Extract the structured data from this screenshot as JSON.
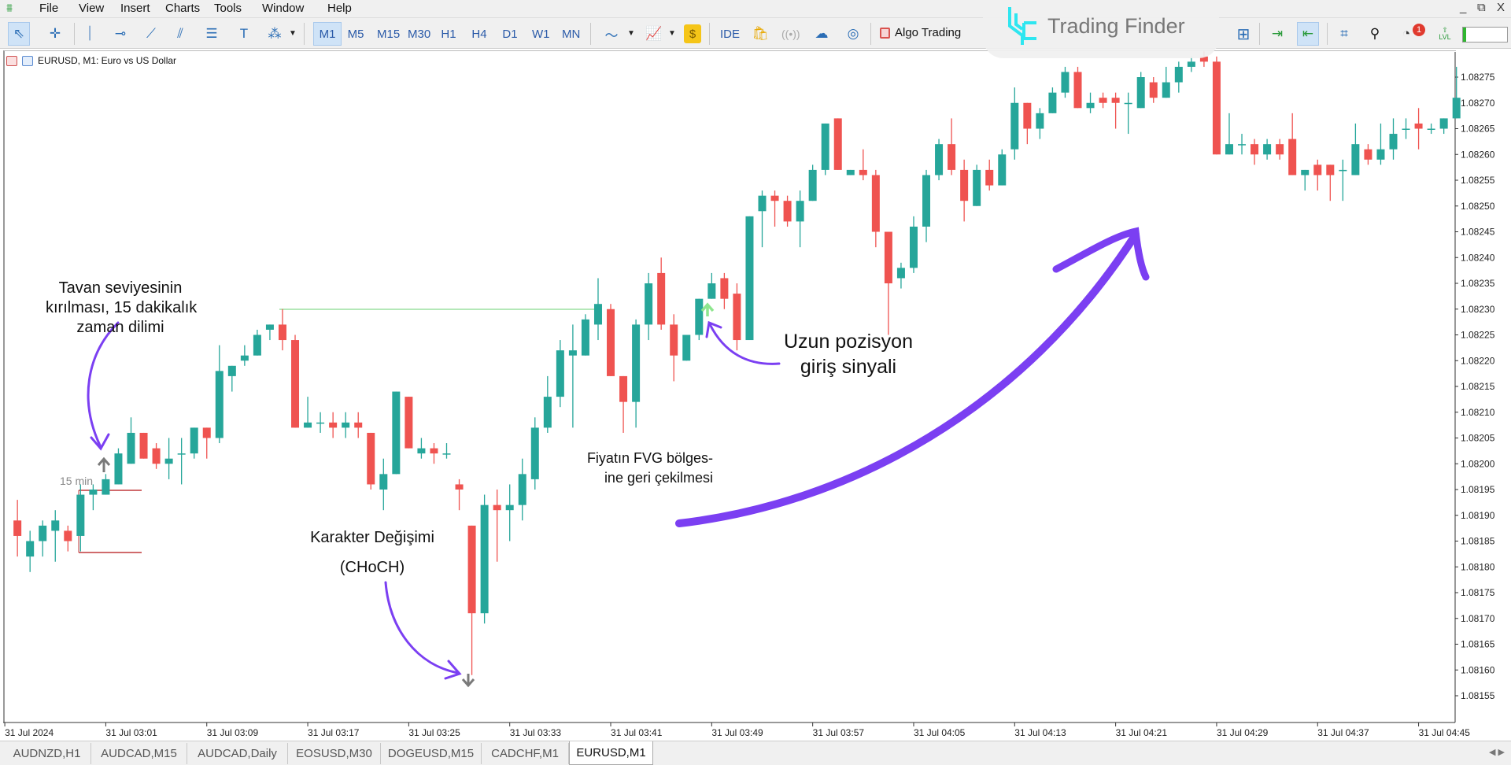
{
  "menu": {
    "items": [
      "File",
      "View",
      "Insert",
      "Charts",
      "Tools",
      "Window",
      "Help"
    ]
  },
  "window_controls": {
    "minimize": "_",
    "restore": "⧉",
    "close": "X"
  },
  "toolbar": {
    "tools": [
      {
        "name": "cursor",
        "glyph": "⇖",
        "active": true
      },
      {
        "name": "crosshair",
        "glyph": "✛"
      },
      {
        "name": "vertical-line",
        "glyph": "⏐"
      },
      {
        "name": "horizontal-line",
        "glyph": "⊸"
      },
      {
        "name": "trend-line",
        "glyph": "⟋"
      },
      {
        "name": "channels",
        "glyph": "⫽"
      },
      {
        "name": "fibonacci",
        "glyph": "☰"
      },
      {
        "name": "text",
        "glyph": "T"
      },
      {
        "name": "shapes",
        "glyph": "⁂"
      }
    ],
    "timeframes": [
      "M1",
      "M5",
      "M15",
      "M30",
      "H1",
      "H4",
      "D1",
      "W1",
      "MN"
    ],
    "active_timeframe": "M1",
    "ide_label": "IDE",
    "algo_trading_label": "Algo Trading",
    "notification_count": "1",
    "lvl_label": "LVL",
    "level_fill_percent": 7
  },
  "watermark": {
    "text": "Trading Finder",
    "color": "#2ee6f0"
  },
  "chart": {
    "title": "EURUSD, M1:  Euro vs US Dollar"
  },
  "colors": {
    "bull": "#26a69a",
    "bear": "#ef5350",
    "annotation_arrow": "#7b3ff2",
    "fvg_line": "#9be0a0",
    "box_line": "#c0393b"
  },
  "annotations": {
    "breakout": [
      "Tavan seviyesinin",
      "kırılması, 15 dakikalık",
      "zaman dilimi"
    ],
    "box_label": "15 min",
    "choch": [
      "Karakter Değişimi",
      "(CHoCH)"
    ],
    "fvg": [
      "Fiyatın FVG bölges-",
      "ine geri çekilmesi"
    ],
    "entry": [
      "Uzun pozisyon",
      "giriş sinyali"
    ]
  },
  "chart_data": {
    "type": "candlestick",
    "symbol": "EURUSD",
    "timeframe": "M1",
    "y_ticks": [
      "1.08275",
      "1.08270",
      "1.08265",
      "1.08260",
      "1.08255",
      "1.08250",
      "1.08245",
      "1.08240",
      "1.08235",
      "1.08230",
      "1.08225",
      "1.08220",
      "1.08215",
      "1.08210",
      "1.08205",
      "1.08200",
      "1.08195",
      "1.08190",
      "1.08185",
      "1.08180",
      "1.08175",
      "1.08170",
      "1.08165",
      "1.08160",
      "1.08155"
    ],
    "x_labels": [
      "31 Jul 2024",
      "31 Jul 03:01",
      "31 Jul 03:09",
      "31 Jul 03:17",
      "31 Jul 03:25",
      "31 Jul 03:33",
      "31 Jul 03:41",
      "31 Jul 03:49",
      "31 Jul 03:57",
      "31 Jul 04:05",
      "31 Jul 04:13",
      "31 Jul 04:21",
      "31 Jul 04:29",
      "31 Jul 04:37",
      "31 Jul 04:45"
    ],
    "ylim": [
      1.0815,
      1.0828
    ],
    "candle_fields": [
      "time",
      "open",
      "high",
      "low",
      "close"
    ],
    "candles": [
      [
        "02:54",
        1.08189,
        1.08193,
        1.08182,
        1.08186
      ],
      [
        "02:55",
        1.08182,
        1.08187,
        1.08179,
        1.08185
      ],
      [
        "02:56",
        1.08185,
        1.08189,
        1.08182,
        1.08188
      ],
      [
        "02:57",
        1.08187,
        1.08191,
        1.08181,
        1.08189
      ],
      [
        "02:58",
        1.08187,
        1.08188,
        1.08183,
        1.08185
      ],
      [
        "02:59",
        1.08186,
        1.08196,
        1.08183,
        1.08194
      ],
      [
        "03:00",
        1.08194,
        1.08196,
        1.08191,
        1.08195
      ],
      [
        "03:01",
        1.08194,
        1.08198,
        1.08194,
        1.08197
      ],
      [
        "03:02",
        1.08196,
        1.08203,
        1.08196,
        1.08202
      ],
      [
        "03:03",
        1.082,
        1.08209,
        1.082,
        1.08206
      ],
      [
        "03:04",
        1.08206,
        1.08206,
        1.08201,
        1.08201
      ],
      [
        "03:05",
        1.08203,
        1.08204,
        1.08199,
        1.082
      ],
      [
        "03:06",
        1.082,
        1.08205,
        1.08197,
        1.08201
      ],
      [
        "03:07",
        1.08202,
        1.08205,
        1.08196,
        1.08202
      ],
      [
        "03:08",
        1.08202,
        1.08207,
        1.08201,
        1.08207
      ],
      [
        "03:09",
        1.08207,
        1.08207,
        1.08201,
        1.08205
      ],
      [
        "03:10",
        1.08205,
        1.08223,
        1.08204,
        1.08218
      ],
      [
        "03:11",
        1.08217,
        1.08219,
        1.08214,
        1.08219
      ],
      [
        "03:12",
        1.0822,
        1.08223,
        1.08219,
        1.08221
      ],
      [
        "03:13",
        1.08221,
        1.08226,
        1.08221,
        1.08225
      ],
      [
        "03:14",
        1.08226,
        1.08227,
        1.08224,
        1.08227
      ],
      [
        "03:15",
        1.08227,
        1.0823,
        1.08222,
        1.08224
      ],
      [
        "03:16",
        1.08224,
        1.08225,
        1.08207,
        1.08207
      ],
      [
        "03:17",
        1.08207,
        1.08213,
        1.08207,
        1.08208
      ],
      [
        "03:18",
        1.08208,
        1.0821,
        1.08206,
        1.08208
      ],
      [
        "03:19",
        1.08208,
        1.0821,
        1.08205,
        1.08207
      ],
      [
        "03:20",
        1.08207,
        1.0821,
        1.08205,
        1.08208
      ],
      [
        "03:21",
        1.08208,
        1.0821,
        1.08205,
        1.08207
      ],
      [
        "03:22",
        1.08206,
        1.08206,
        1.08195,
        1.08196
      ],
      [
        "03:23",
        1.08195,
        1.08201,
        1.08191,
        1.08198
      ],
      [
        "03:24",
        1.08198,
        1.08214,
        1.08198,
        1.08214
      ],
      [
        "03:25",
        1.08213,
        1.08213,
        1.08203,
        1.08203
      ],
      [
        "03:26",
        1.08202,
        1.08205,
        1.08201,
        1.08203
      ],
      [
        "03:27",
        1.08203,
        1.08204,
        1.082,
        1.08202
      ],
      [
        "03:28",
        1.08202,
        1.08204,
        1.08201,
        1.08202
      ],
      [
        "03:29",
        1.08196,
        1.08197,
        1.08191,
        1.08195
      ],
      [
        "03:30",
        1.08188,
        1.08188,
        1.08159,
        1.08171
      ],
      [
        "03:31",
        1.08171,
        1.08194,
        1.08169,
        1.08192
      ],
      [
        "03:32",
        1.08192,
        1.08195,
        1.08181,
        1.08191
      ],
      [
        "03:33",
        1.08191,
        1.08196,
        1.08185,
        1.08192
      ],
      [
        "03:34",
        1.08192,
        1.08201,
        1.08189,
        1.08198
      ],
      [
        "03:35",
        1.08197,
        1.08209,
        1.08195,
        1.08207
      ],
      [
        "03:36",
        1.08207,
        1.08217,
        1.08206,
        1.08213
      ],
      [
        "03:37",
        1.08213,
        1.08224,
        1.08211,
        1.08222
      ],
      [
        "03:38",
        1.08221,
        1.08227,
        1.08207,
        1.08222
      ],
      [
        "03:39",
        1.08221,
        1.08229,
        1.08221,
        1.08228
      ],
      [
        "03:40",
        1.08227,
        1.08236,
        1.08224,
        1.08231
      ],
      [
        "03:41",
        1.0823,
        1.08231,
        1.08217,
        1.08217
      ],
      [
        "03:42",
        1.08217,
        1.08217,
        1.08206,
        1.08212
      ],
      [
        "03:43",
        1.08212,
        1.08228,
        1.08207,
        1.08227
      ],
      [
        "03:44",
        1.08227,
        1.08237,
        1.08224,
        1.08235
      ],
      [
        "03:45",
        1.08237,
        1.0824,
        1.08226,
        1.08227
      ],
      [
        "03:46",
        1.08227,
        1.08229,
        1.08216,
        1.08221
      ],
      [
        "03:47",
        1.0822,
        1.08225,
        1.0822,
        1.08225
      ],
      [
        "03:48",
        1.08225,
        1.08232,
        1.08224,
        1.08232
      ],
      [
        "03:49",
        1.08232,
        1.08237,
        1.08232,
        1.08235
      ],
      [
        "03:50",
        1.08236,
        1.08237,
        1.0823,
        1.08232
      ],
      [
        "03:51",
        1.08233,
        1.08235,
        1.08222,
        1.08224
      ],
      [
        "03:52",
        1.08224,
        1.08248,
        1.08224,
        1.08248
      ],
      [
        "03:53",
        1.08249,
        1.08253,
        1.08242,
        1.08252
      ],
      [
        "03:54",
        1.08252,
        1.08253,
        1.08246,
        1.08251
      ],
      [
        "03:55",
        1.08251,
        1.08252,
        1.08246,
        1.08247
      ],
      [
        "03:56",
        1.08247,
        1.08253,
        1.08242,
        1.08251
      ],
      [
        "03:57",
        1.08251,
        1.08258,
        1.08251,
        1.08257
      ],
      [
        "03:58",
        1.08257,
        1.08266,
        1.08256,
        1.08266
      ],
      [
        "03:59",
        1.08267,
        1.08267,
        1.08257,
        1.08257
      ],
      [
        "04:00",
        1.08256,
        1.08257,
        1.08256,
        1.08257
      ],
      [
        "04:01",
        1.08257,
        1.08261,
        1.08255,
        1.08256
      ],
      [
        "04:02",
        1.08256,
        1.08257,
        1.08242,
        1.08245
      ],
      [
        "04:03",
        1.08245,
        1.08245,
        1.08225,
        1.08235
      ],
      [
        "04:04",
        1.08236,
        1.08239,
        1.08234,
        1.08238
      ],
      [
        "04:05",
        1.08238,
        1.08248,
        1.08237,
        1.08246
      ],
      [
        "04:06",
        1.08246,
        1.08257,
        1.08243,
        1.08256
      ],
      [
        "04:07",
        1.08256,
        1.08263,
        1.08255,
        1.08262
      ],
      [
        "04:08",
        1.08262,
        1.08267,
        1.08256,
        1.08257
      ],
      [
        "04:09",
        1.08257,
        1.08259,
        1.08247,
        1.08251
      ],
      [
        "04:10",
        1.0825,
        1.08258,
        1.0825,
        1.08257
      ],
      [
        "04:11",
        1.08257,
        1.08259,
        1.08253,
        1.08254
      ],
      [
        "04:12",
        1.08254,
        1.08261,
        1.08254,
        1.0826
      ],
      [
        "04:13",
        1.08261,
        1.08273,
        1.08259,
        1.0827
      ],
      [
        "04:14",
        1.0827,
        1.0827,
        1.08262,
        1.08265
      ],
      [
        "04:15",
        1.08265,
        1.08269,
        1.08263,
        1.08268
      ],
      [
        "04:16",
        1.08268,
        1.08273,
        1.08268,
        1.08272
      ],
      [
        "04:17",
        1.08272,
        1.08277,
        1.08271,
        1.08276
      ],
      [
        "04:18",
        1.08276,
        1.08277,
        1.08269,
        1.08269
      ],
      [
        "04:19",
        1.08269,
        1.08272,
        1.08268,
        1.0827
      ],
      [
        "04:20",
        1.08271,
        1.08272,
        1.08269,
        1.0827
      ],
      [
        "04:21",
        1.08271,
        1.08272,
        1.08265,
        1.0827
      ],
      [
        "04:22",
        1.0827,
        1.08272,
        1.08264,
        1.0827
      ],
      [
        "04:23",
        1.08269,
        1.08276,
        1.08269,
        1.08275
      ],
      [
        "04:24",
        1.08274,
        1.08275,
        1.0827,
        1.08271
      ],
      [
        "04:25",
        1.08271,
        1.08277,
        1.08271,
        1.08274
      ],
      [
        "04:26",
        1.08274,
        1.08278,
        1.08272,
        1.08277
      ],
      [
        "04:27",
        1.08277,
        1.08279,
        1.08276,
        1.08278
      ],
      [
        "04:28",
        1.08279,
        1.0828,
        1.08277,
        1.08278
      ],
      [
        "04:29",
        1.08278,
        1.08279,
        1.0826,
        1.0826
      ],
      [
        "04:30",
        1.0826,
        1.08268,
        1.0826,
        1.08262
      ],
      [
        "04:31",
        1.08262,
        1.08264,
        1.0826,
        1.08262
      ],
      [
        "04:32",
        1.08262,
        1.08263,
        1.08258,
        1.0826
      ],
      [
        "04:33",
        1.0826,
        1.08263,
        1.08259,
        1.08262
      ],
      [
        "04:34",
        1.08262,
        1.08263,
        1.08259,
        1.0826
      ],
      [
        "04:35",
        1.08263,
        1.08268,
        1.08256,
        1.08256
      ],
      [
        "04:36",
        1.08256,
        1.08257,
        1.08253,
        1.08257
      ],
      [
        "04:37",
        1.08258,
        1.08259,
        1.08253,
        1.08256
      ],
      [
        "04:38",
        1.08258,
        1.08258,
        1.08251,
        1.08256
      ],
      [
        "04:39",
        1.08257,
        1.08259,
        1.08251,
        1.08257
      ],
      [
        "04:40",
        1.08256,
        1.08266,
        1.08256,
        1.08262
      ],
      [
        "04:41",
        1.08261,
        1.08262,
        1.08258,
        1.08259
      ],
      [
        "04:42",
        1.08259,
        1.08266,
        1.08258,
        1.08261
      ],
      [
        "04:43",
        1.08261,
        1.08267,
        1.08259,
        1.08264
      ],
      [
        "04:44",
        1.08265,
        1.08267,
        1.08263,
        1.08265
      ],
      [
        "04:45",
        1.08266,
        1.08269,
        1.08261,
        1.08265
      ],
      [
        "04:46",
        1.08265,
        1.08266,
        1.08264,
        1.08265
      ],
      [
        "04:47",
        1.08265,
        1.08267,
        1.08264,
        1.08267
      ],
      [
        "04:48",
        1.08267,
        1.08277,
        1.08267,
        1.08271
      ]
    ]
  },
  "tabs": [
    {
      "label": "AUDNZD,H1"
    },
    {
      "label": "AUDCAD,M15"
    },
    {
      "label": "AUDCAD,Daily"
    },
    {
      "label": "EOSUSD,M30"
    },
    {
      "label": "DOGEUSD,M15"
    },
    {
      "label": "CADCHF,M1"
    },
    {
      "label": "EURUSD,M1",
      "active": true
    }
  ]
}
